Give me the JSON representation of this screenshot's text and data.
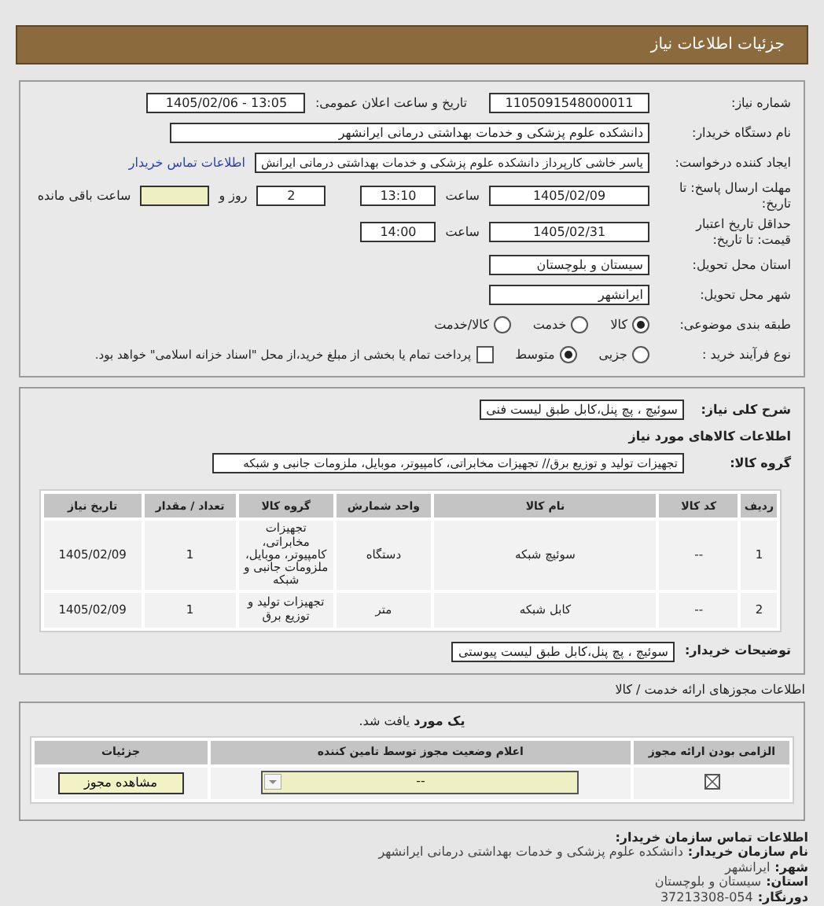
{
  "header": {
    "title": "جزئیات اطلاعات نیاز"
  },
  "need_number": {
    "label": "شماره نیاز:",
    "value": "1105091548000011"
  },
  "announce": {
    "label": "تاریخ و ساعت اعلان عمومی:",
    "value": "1405/02/06 - 13:05"
  },
  "buyer_org": {
    "label": "نام دستگاه خریدار:",
    "value": "دانشکده علوم پزشکی و خدمات بهداشتی درمانی ایرانشهر"
  },
  "requester": {
    "label": "ایجاد کننده درخواست:",
    "value": "یاسر خاشی کارپرداز دانشکده علوم پزشکی و خدمات بهداشتی درمانی ایرانش",
    "link": "اطلاعات تماس خریدار"
  },
  "deadline": {
    "label": "مهلت ارسال پاسخ: تا تاریخ:",
    "date": "1405/02/09",
    "time_label": "ساعت",
    "time": "13:10",
    "days": "2",
    "days_label": "روز و",
    "remaining_label": "ساعت باقی مانده"
  },
  "validity": {
    "label": "حداقل تاریخ اعتبار قیمت: تا تاریخ:",
    "date": "1405/02/31",
    "time_label": "ساعت",
    "time": "14:00"
  },
  "province": {
    "label": "استان محل تحویل:",
    "value": "سیستان و بلوچستان"
  },
  "city": {
    "label": "شهر محل تحویل:",
    "value": "ایرانشهر"
  },
  "category": {
    "label": "طبقه بندی موضوعی:",
    "options": [
      {
        "label": "کالا",
        "selected": true
      },
      {
        "label": "خدمت",
        "selected": false
      },
      {
        "label": "کالا/خدمت",
        "selected": false
      }
    ]
  },
  "process": {
    "label": "نوع فرآیند خرید :",
    "options": [
      {
        "label": "جزیی",
        "selected": false
      },
      {
        "label": "متوسط",
        "selected": true
      }
    ],
    "payment": {
      "label": "پرداخت تمام یا بخشی از مبلغ خرید،از محل \"اسناد خزانه اسلامی\" خواهد بود.",
      "checked": false
    }
  },
  "summary": {
    "label": "شرح کلی نیاز:",
    "value": "سوئیچ ، پچ پنل،کابل طبق لیست فنی"
  },
  "goods_heading": "اطلاعات کالاهای مورد نیاز",
  "goods_group": {
    "label": "گروه کالا:",
    "value": "تجهیزات تولید و توزیع برق// تجهیزات مخابراتی، کامپیوتر، موبایل، ملزومات جانبی و شبکه"
  },
  "goods_table": {
    "columns": [
      "ردیف",
      "کد کالا",
      "نام کالا",
      "واحد شمارش",
      "گروه کالا",
      "تعداد / مقدار",
      "تاریخ نیاز"
    ],
    "rows": [
      {
        "cells": [
          "1",
          "--",
          "سوئیچ شبکه",
          "دستگاه",
          "تجهیزات مخابراتی، کامپیوتر، موبایل، ملزومات جانبی و شبکه",
          "1",
          "1405/02/09"
        ]
      },
      {
        "cells": [
          "2",
          "--",
          "کابل شبکه",
          "متر",
          "تجهیزات تولید و توزیع برق",
          "1",
          "1405/02/09"
        ]
      }
    ]
  },
  "buyer_notes": {
    "label": "توضیحات خریدار:",
    "value": "سوئیچ ، پچ پنل،کابل طبق لیست پیوستی"
  },
  "permits": {
    "title": "اطلاعات مجوزهای ارائه خدمت / کالا",
    "found": "**یک مورد** یافت شد.",
    "columns": [
      "الزامی بودن ارائه مجوز",
      "اعلام وضعیت مجوز توسط تامین کننده",
      "جزئیات"
    ],
    "rows": [
      {
        "required": true,
        "status": "--",
        "button": "مشاهده مجوز"
      }
    ]
  },
  "contact": {
    "title": "اطلاعات تماس سازمان خریدار:",
    "lines": [
      {
        "label": "نام سازمان خریدار:",
        "value": "دانشکده علوم پزشکی و خدمات بهداشتی درمانی ایرانشهر"
      },
      {
        "label": "شهر:",
        "value": "ایرانشهر"
      },
      {
        "label": "استان:",
        "value": "سیستان و بلوچستان"
      },
      {
        "label": "دورنگار:",
        "value": "37213308-054"
      }
    ]
  }
}
